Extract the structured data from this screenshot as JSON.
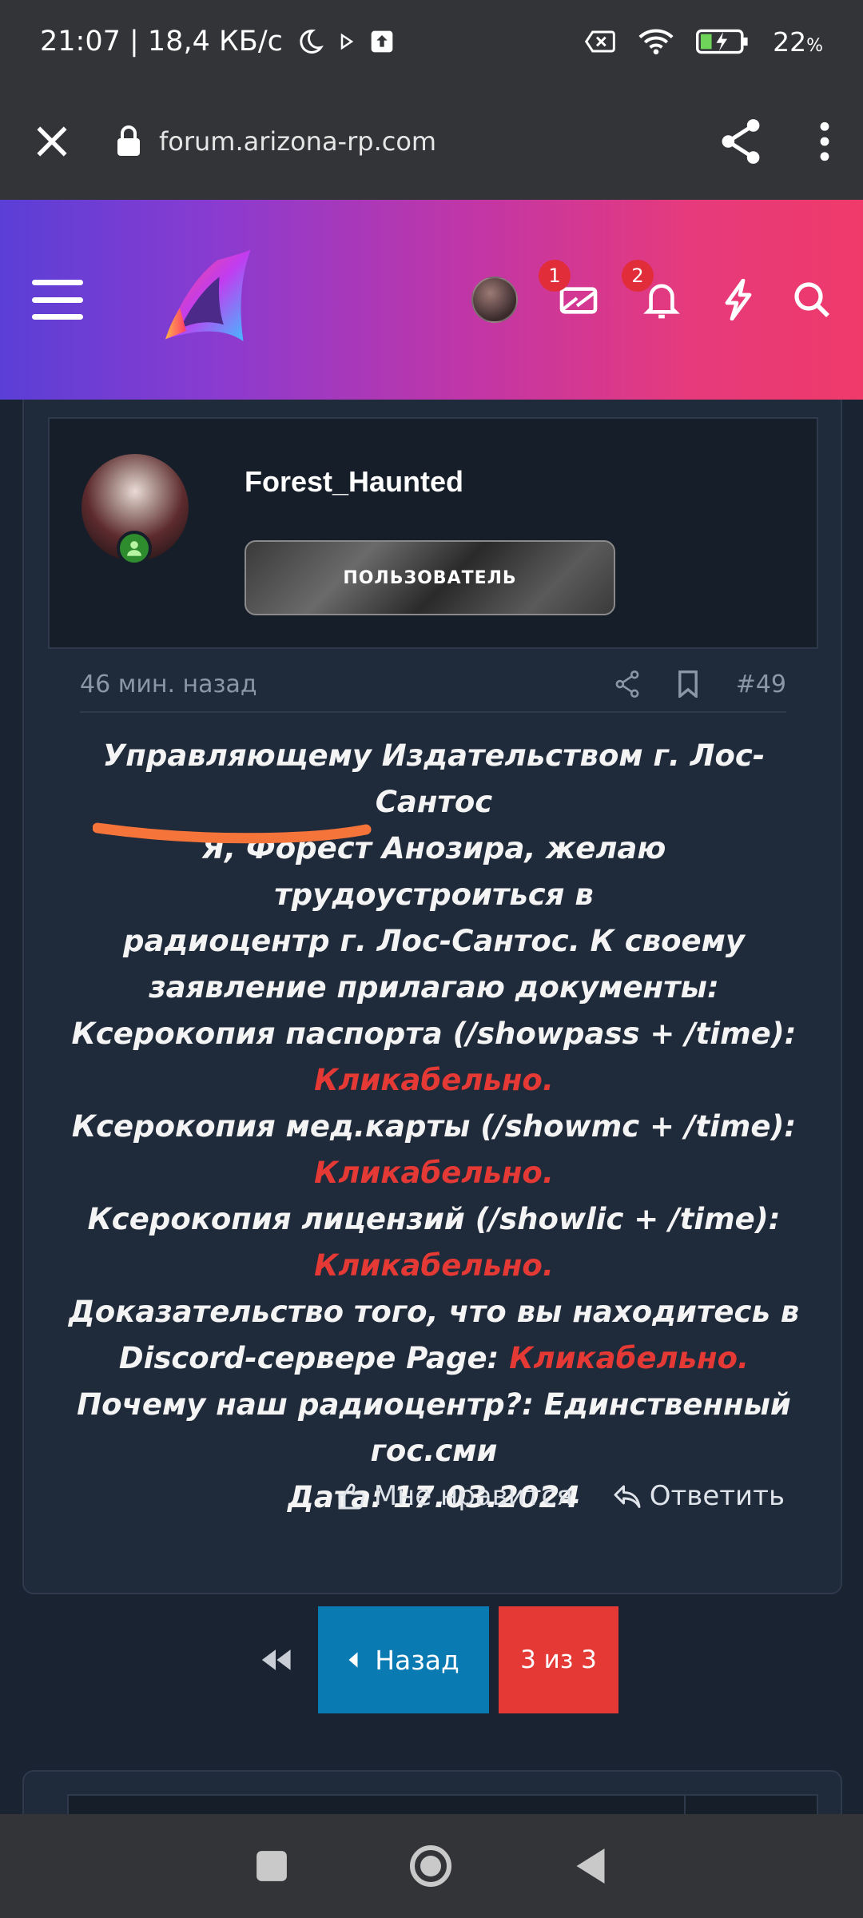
{
  "status_bar": {
    "time_speed": "21:07 | 18,4 КБ/с",
    "battery_percent": "22",
    "battery_suffix": "%"
  },
  "browser": {
    "url": "forum.arizona-rp.com"
  },
  "header": {
    "messages_badge": "1",
    "notifications_badge": "2"
  },
  "post": {
    "username": "Forest_Haunted",
    "role": "ПОЛЬЗОВАТЕЛЬ",
    "time": "46 мин. назад",
    "number": "#49",
    "lines": {
      "l1": "Управляющему Издательством г. Лос-Сантос",
      "l2": "Я, Форест Анозира, желаю трудоустроиться в",
      "l3": "радиоцентр г. Лос-Сантос. К своему",
      "l4": "заявление прилагаю документы:",
      "l5": "Ксерокопия паспорта (/showpass + /time):",
      "l6": "Кликабельно.",
      "l7": "Ксерокопия мед.карты (/showmc + /time):",
      "l8": "Кликабельно.",
      "l9": "Ксерокопия лицензий (/showlic + /time):",
      "l10": "Кликабельно.",
      "l11": "Доказательство того, что вы находитесь в",
      "l12a": "Discord-сервере Page: ",
      "l12b": "Кликабельно.",
      "l13": "Почему наш радиоцентр?: Единственный",
      "l14": "гос.сми",
      "l15": "Дата: 17.03.2024"
    },
    "like_label": "Мне нравится",
    "reply_label": "Ответить"
  },
  "pagination": {
    "prev_label": "Назад",
    "page_label": "3 из 3"
  },
  "colors": {
    "link_red": "#e53935",
    "prev_blue": "#0a7ab3",
    "page_red": "#e53935"
  }
}
